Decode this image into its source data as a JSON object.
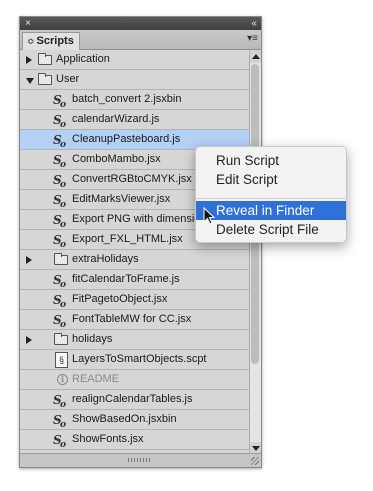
{
  "panel": {
    "title": "Scripts",
    "close_glyph": "×",
    "collapse_glyph": "‹‹",
    "sort_glyph": "≎",
    "menu_glyph": "▾≡"
  },
  "rows": [
    {
      "type": "folder",
      "indent": 0,
      "expanded": false,
      "label": "Application"
    },
    {
      "type": "folder",
      "indent": 0,
      "expanded": true,
      "label": "User"
    },
    {
      "type": "js",
      "indent": 1,
      "label": "batch_convert 2.jsxbin"
    },
    {
      "type": "js",
      "indent": 1,
      "label": "calendarWizard.js"
    },
    {
      "type": "js",
      "indent": 1,
      "label": "CleanupPasteboard.js",
      "selected": true
    },
    {
      "type": "js",
      "indent": 1,
      "label": "ComboMambo.jsx"
    },
    {
      "type": "js",
      "indent": 1,
      "label": "ConvertRGBtoCMYK.jsx"
    },
    {
      "type": "js",
      "indent": 1,
      "label": "EditMarksViewer.jsx"
    },
    {
      "type": "js",
      "indent": 1,
      "label": "Export PNG with dimensions.js"
    },
    {
      "type": "js",
      "indent": 1,
      "label": "Export_FXL_HTML.jsx"
    },
    {
      "type": "folder",
      "indent": 1,
      "expanded": false,
      "label": "extraHolidays"
    },
    {
      "type": "js",
      "indent": 1,
      "label": "fitCalendarToFrame.js"
    },
    {
      "type": "js",
      "indent": 1,
      "label": "FitPagetoObject.jsx"
    },
    {
      "type": "js",
      "indent": 1,
      "label": "FontTableMW for CC.jsx"
    },
    {
      "type": "folder",
      "indent": 1,
      "expanded": false,
      "label": "holidays"
    },
    {
      "type": "scpt",
      "indent": 1,
      "label": "LayersToSmartObjects.scpt"
    },
    {
      "type": "info",
      "indent": 1,
      "label": "README",
      "dim": true
    },
    {
      "type": "js",
      "indent": 1,
      "label": "realignCalendarTables.js"
    },
    {
      "type": "js",
      "indent": 1,
      "label": "ShowBasedOn.jsxbin"
    },
    {
      "type": "js",
      "indent": 1,
      "label": "ShowFonts.jsx"
    }
  ],
  "context_menu": {
    "items": [
      {
        "label": "Run Script"
      },
      {
        "label": "Edit Script"
      },
      {
        "label": "Reveal in Finder",
        "highlighted": true
      },
      {
        "label": "Delete Script File"
      }
    ]
  },
  "colors": {
    "selection": "#b3d0f5",
    "menu_highlight": "#2f6fd8"
  }
}
